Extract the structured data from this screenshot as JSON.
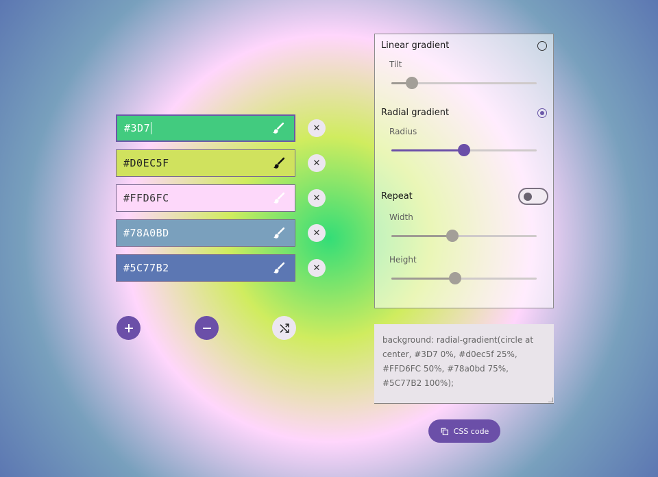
{
  "colors": [
    {
      "hex": "#3D7",
      "bg": "#42cb7f",
      "text_color": "#ffffff",
      "icon_color": "#ffffff",
      "active": true
    },
    {
      "hex": "#D0EC5F",
      "bg": "#d0e25e",
      "text_color": "#222222",
      "icon_color": "#111111",
      "active": false
    },
    {
      "hex": "#FFD6FC",
      "bg": "#fdd8fa",
      "text_color": "#333333",
      "icon_color": "#ffffff",
      "active": false
    },
    {
      "hex": "#78A0BD",
      "bg": "#7aa0bd",
      "text_color": "#ffffff",
      "icon_color": "#ffffff",
      "active": false
    },
    {
      "hex": "#5C77B2",
      "bg": "#5c77b3",
      "text_color": "#ffffff",
      "icon_color": "#ffffff",
      "active": false
    }
  ],
  "controls": {
    "add_symbol": "+",
    "remove_symbol": "−",
    "remove_row_symbol": "✕"
  },
  "options": {
    "linear": {
      "label": "Linear gradient",
      "selected": false,
      "tilt_label": "Tilt",
      "tilt_value": 0.14
    },
    "radial": {
      "label": "Radial gradient",
      "selected": true,
      "radius_label": "Radius",
      "radius_value": 0.5
    },
    "repeat": {
      "label": "Repeat",
      "enabled": false,
      "width_label": "Width",
      "width_value": 0.42,
      "height_label": "Height",
      "height_value": 0.44
    }
  },
  "css_output": "background: radial-gradient(circle at center, #3D7 0%, #d0ec5f 25%, #FFD6FC 50%, #78a0bd 75%, #5C77B2 100%);",
  "css_button_label": "CSS code",
  "accent_color": "#6b4fa8"
}
